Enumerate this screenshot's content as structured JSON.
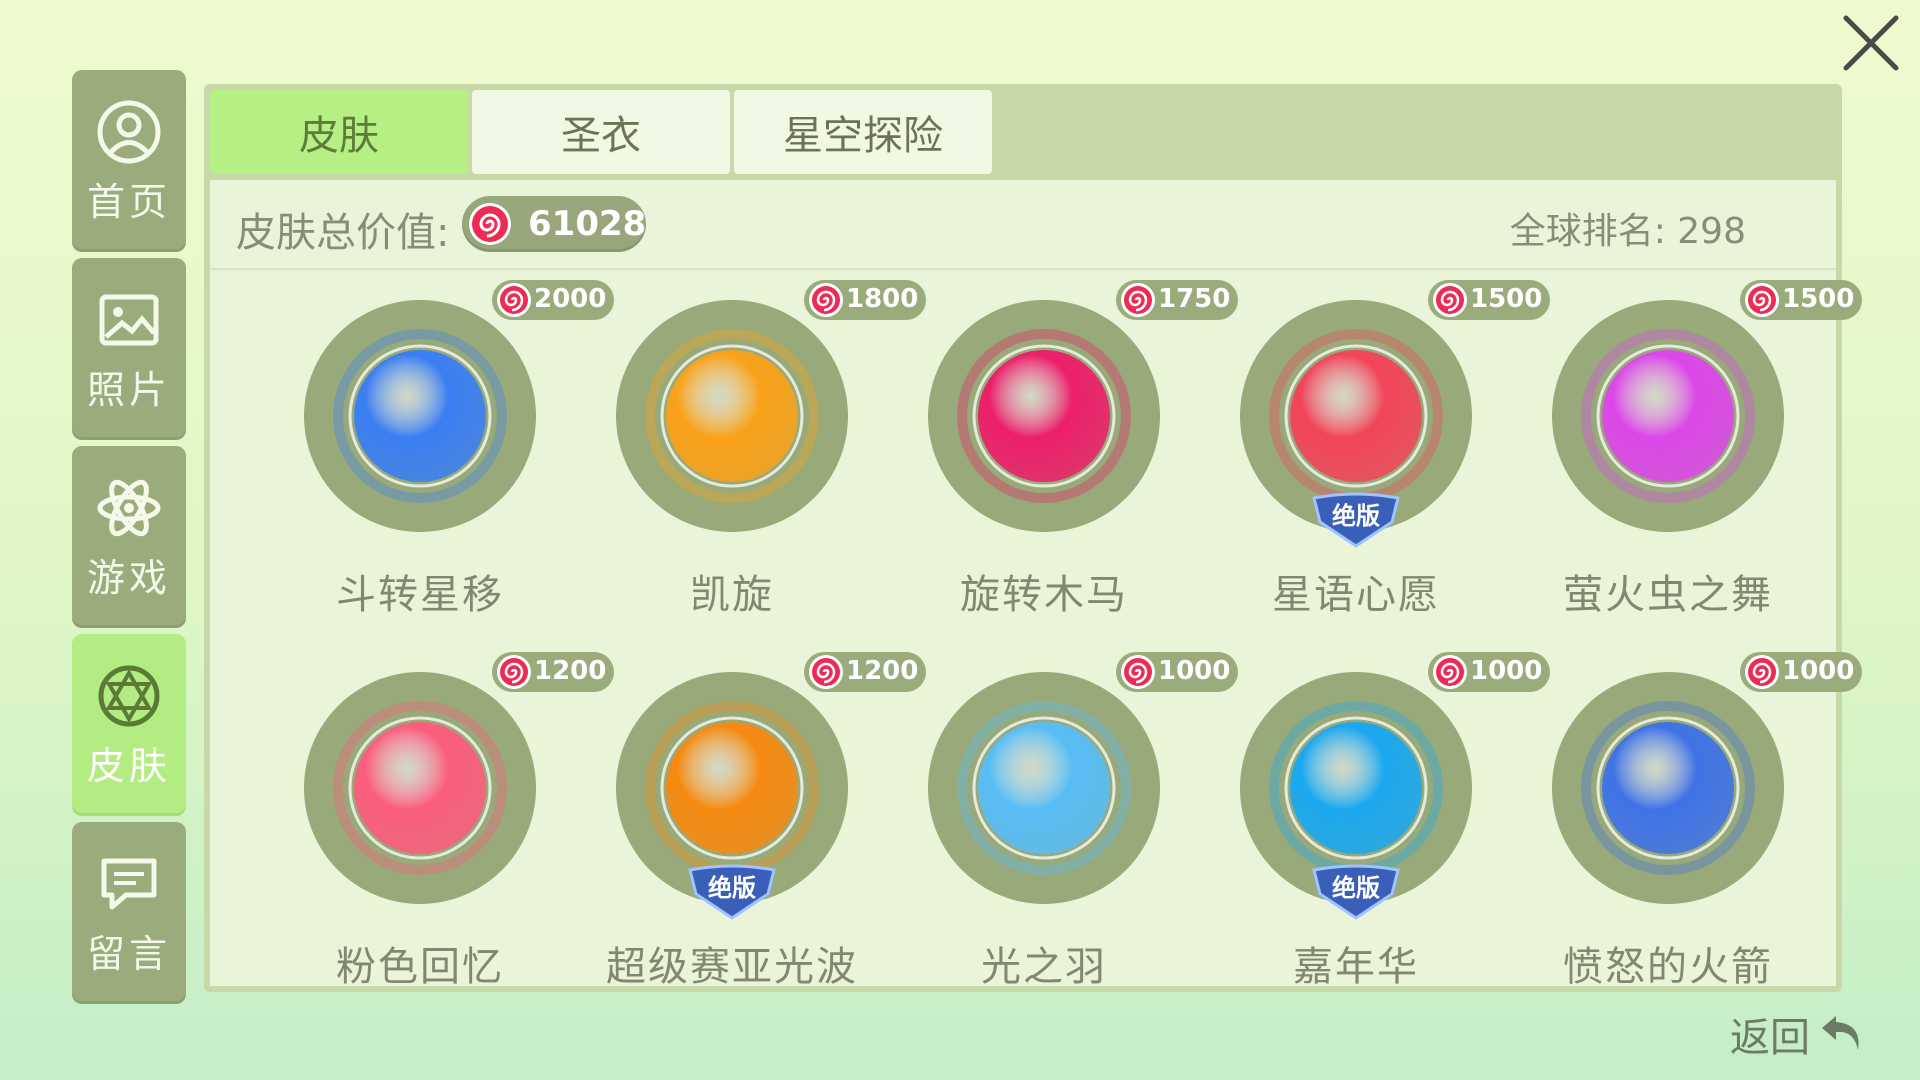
{
  "sidebar": {
    "items": [
      {
        "label": "首页",
        "icon": "user-circle-icon"
      },
      {
        "label": "照片",
        "icon": "image-icon"
      },
      {
        "label": "游戏",
        "icon": "atom-icon"
      },
      {
        "label": "皮肤",
        "icon": "palette-icon"
      },
      {
        "label": "留言",
        "icon": "chat-icon"
      }
    ],
    "active": "皮肤"
  },
  "tabs": [
    {
      "label": "皮肤",
      "active": true
    },
    {
      "label": "圣衣",
      "active": false
    },
    {
      "label": "星空探险",
      "active": false
    }
  ],
  "stats": {
    "total_label": "皮肤总价值:",
    "total_value": "61028",
    "rank": "全球排名: 298"
  },
  "skins": [
    {
      "name": "斗转星移",
      "price": "2000",
      "limited": false,
      "color": "#3a7ef2"
    },
    {
      "name": "凯旋",
      "price": "1800",
      "limited": false,
      "color": "#f9a21a"
    },
    {
      "name": "旋转木马",
      "price": "1750",
      "limited": false,
      "color": "#ec1f6a"
    },
    {
      "name": "星语心愿",
      "price": "1500",
      "limited": true,
      "limited_label": "绝版",
      "color": "#f2455a"
    },
    {
      "name": "萤火虫之舞",
      "price": "1500",
      "limited": false,
      "color": "#dc47e8"
    },
    {
      "name": "粉色回忆",
      "price": "1200",
      "limited": false,
      "color": "#fb5d7d"
    },
    {
      "name": "超级赛亚光波",
      "price": "1200",
      "limited": true,
      "limited_label": "绝版",
      "color": "#f58a12"
    },
    {
      "name": "光之羽",
      "price": "1000",
      "limited": false,
      "color": "#58bdf5"
    },
    {
      "name": "嘉年华",
      "price": "1000",
      "limited": true,
      "limited_label": "绝版",
      "color": "#1ba8f0"
    },
    {
      "name": "愤怒的火箭",
      "price": "1000",
      "limited": false,
      "color": "#3f72e6"
    }
  ],
  "back_label": "返回"
}
